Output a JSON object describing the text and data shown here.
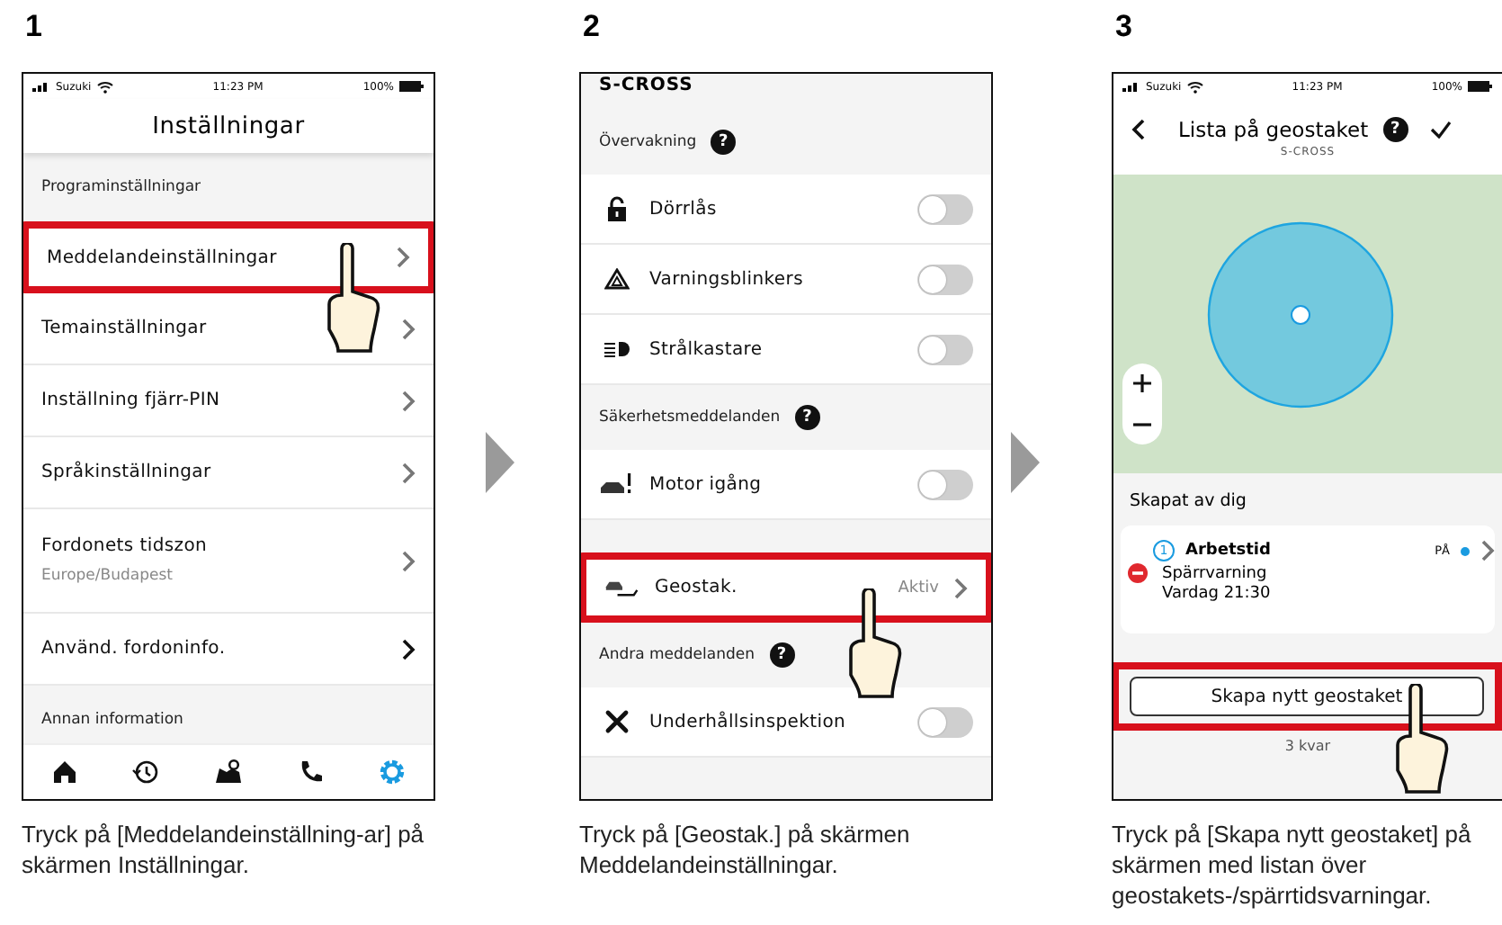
{
  "steps": [
    {
      "number": "1",
      "kind": "settings",
      "status_bar": {
        "carrier": "Suzuki",
        "time": "11:23 PM",
        "battery": "100%"
      },
      "title": "Inställningar",
      "rows": [
        {
          "kind": "header",
          "label": "Programinställningar"
        },
        {
          "kind": "link",
          "label": "Meddelandeinställningar",
          "highlighted": true,
          "tapped": true
        },
        {
          "kind": "link",
          "label": "Temainställningar",
          "highlighted": false,
          "tapped": false
        },
        {
          "kind": "link",
          "label": "Inställning fjärr-PIN",
          "highlighted": false,
          "tapped": false
        },
        {
          "kind": "link",
          "label": "Språkinställningar",
          "highlighted": false,
          "tapped": false
        },
        {
          "kind": "link",
          "label": "Fordonets tidszon",
          "sublabel": "Europe/Budapest",
          "highlighted": false,
          "tapped": false
        },
        {
          "kind": "link",
          "label": "Använd. fordoninfo.",
          "highlighted": false,
          "tapped": false
        },
        {
          "kind": "header",
          "label": "Annan information"
        }
      ],
      "tab_bar": [
        {
          "kind": "home",
          "selected": false
        },
        {
          "kind": "history",
          "selected": false
        },
        {
          "kind": "map",
          "selected": false
        },
        {
          "kind": "phone",
          "selected": false
        },
        {
          "kind": "gear",
          "selected": true
        }
      ],
      "caption": "Tryck på [Meddelandeinställning-ar] på skärmen Inställningar."
    },
    {
      "number": "2",
      "kind": "notifications",
      "top_title": "S-CROSS",
      "rows": [
        {
          "kind": "header",
          "label": "Övervakning",
          "help": "?"
        },
        {
          "kind": "toggle",
          "icon": {
            "kind": "lock"
          },
          "label": "Dörrlås",
          "on": false
        },
        {
          "kind": "toggle",
          "icon": {
            "kind": "hazard"
          },
          "label": "Varningsblinkers",
          "on": false
        },
        {
          "kind": "toggle",
          "icon": {
            "kind": "headlight"
          },
          "label": "Strålkastare",
          "on": false
        },
        {
          "kind": "header",
          "label": "Säkerhetsmeddelanden",
          "help": "?"
        },
        {
          "kind": "toggle",
          "icon": {
            "kind": "engine"
          },
          "label": "Motor igång",
          "on": false
        },
        {
          "kind": "spacer"
        },
        {
          "kind": "link",
          "icon": {
            "kind": "geofence"
          },
          "label": "Geostak.",
          "value": "Aktiv",
          "highlighted": true,
          "tapped": true
        },
        {
          "kind": "header",
          "label": "Andra meddelanden",
          "help": "?"
        },
        {
          "kind": "toggle",
          "icon": {
            "kind": "tools"
          },
          "label": "Underhållsinspektion",
          "on": false
        }
      ],
      "caption": "Tryck på [Geostak.] på skärmen Meddelandeinställningar."
    },
    {
      "number": "3",
      "kind": "geofence_list",
      "status_bar": {
        "carrier": "Suzuki",
        "time": "11:23 PM",
        "battery": "100%"
      },
      "title": "Lista på geostaket",
      "help": "?",
      "subtitle": "S-CROSS",
      "section": "Skapat av dig",
      "fences": [
        {
          "index": "1",
          "name": "Arbetstid",
          "type": "Spärrvarning",
          "schedule": "Vardag 21:30",
          "state": "PÅ",
          "on": true
        }
      ],
      "button": {
        "label": "Skapa nytt geostaket",
        "highlighted": true,
        "tapped": true
      },
      "remaining": "3 kvar",
      "caption": "Tryck på [Skapa nytt geostaket] på skärmen med listan över geostakets-/spärrtidsvarningar."
    }
  ]
}
